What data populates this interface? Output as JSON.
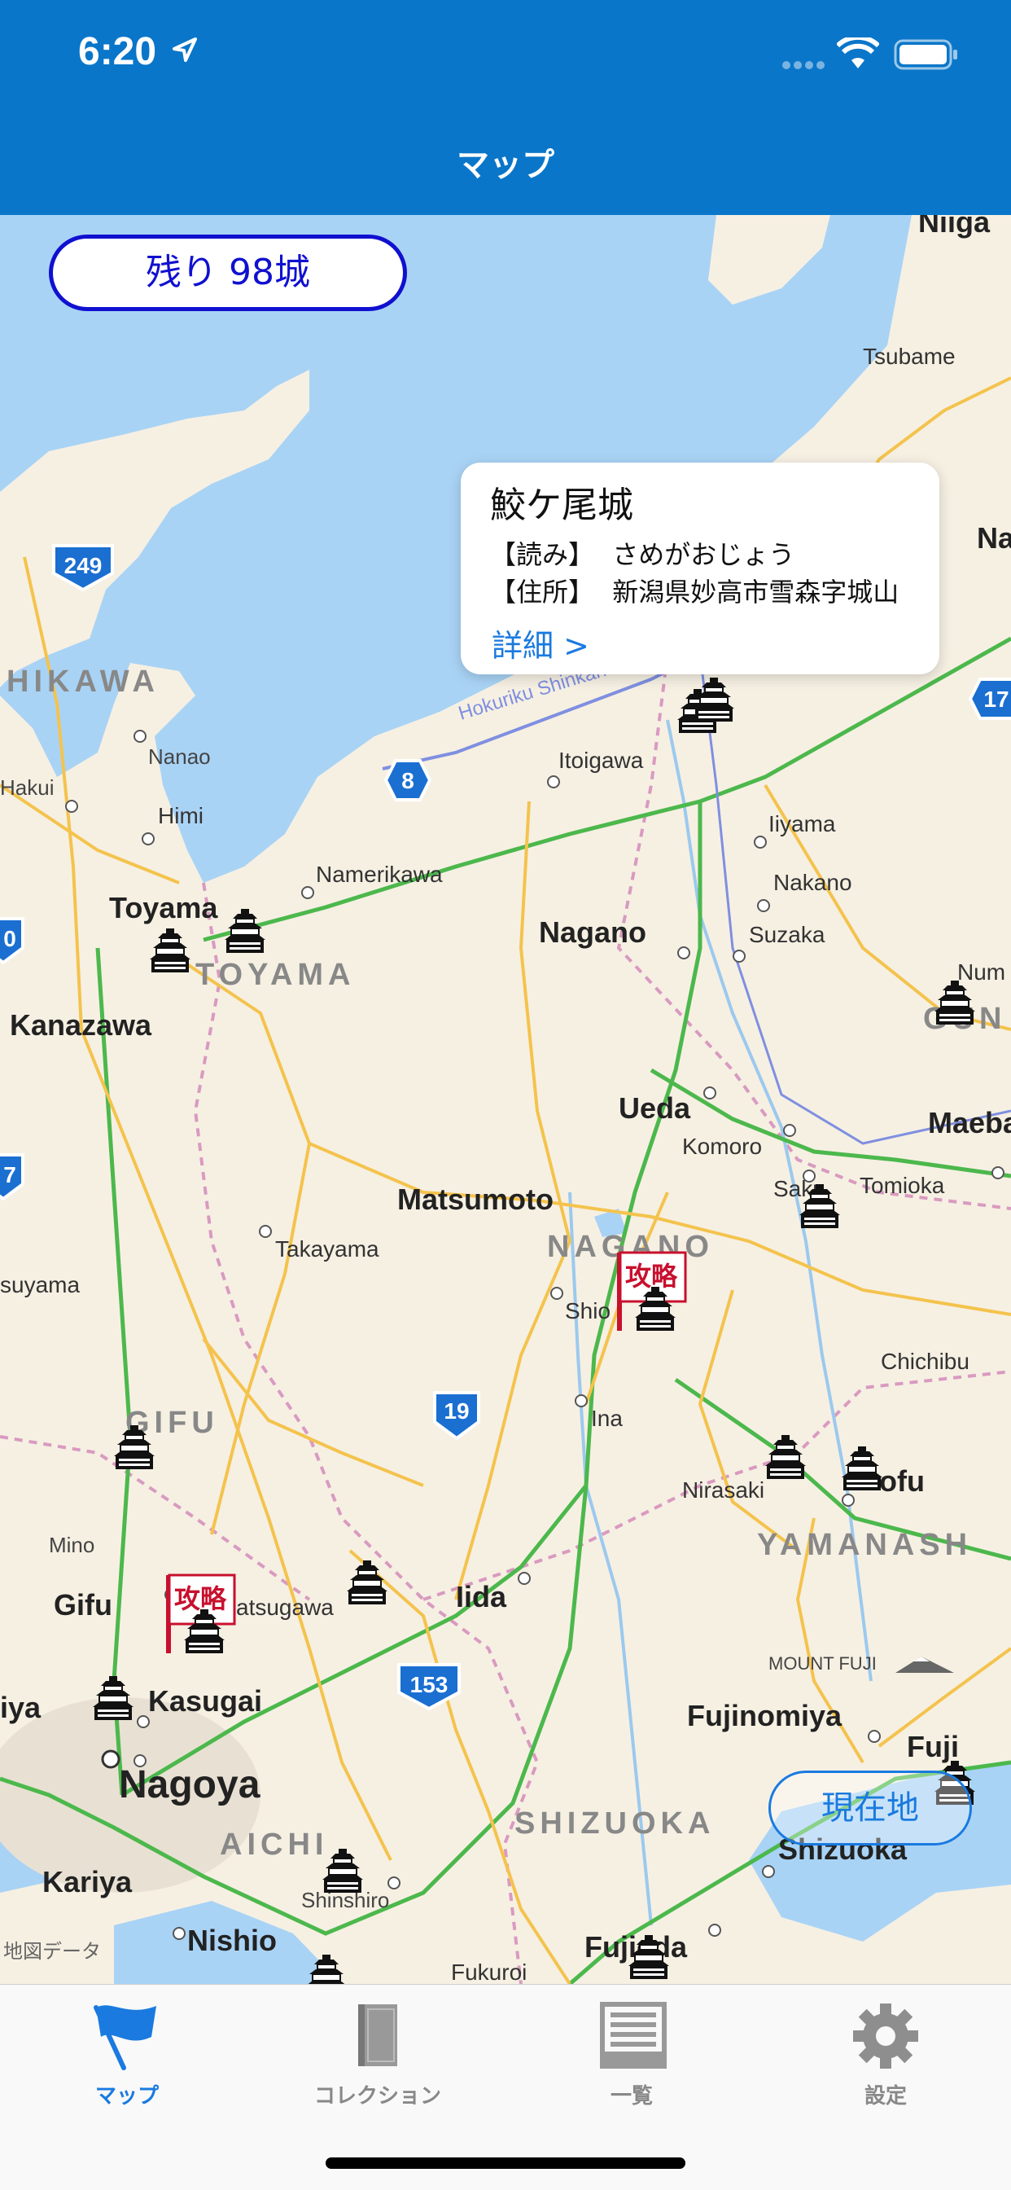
{
  "status": {
    "time": "6:20"
  },
  "nav": {
    "title": "マップ"
  },
  "map": {
    "remaining_label": "残り 98城",
    "current_location_label": "現在地",
    "attribution": "地図データ",
    "places": {
      "niigata": "Niiga",
      "tsubame": "Tsubame",
      "na": "Na",
      "hikawa": "HIKAWA",
      "nanao": "Nanao",
      "hakui": "Hakui",
      "himi": "Himi",
      "itoigawa": "Itoigawa",
      "iiyama": "Iiyama",
      "nakano": "Nakano",
      "namerikawa": "Namerikawa",
      "toyama_city": "Toyama",
      "toyama_pref": "TOYAMA",
      "nagano_city": "Nagano",
      "suzaka": "Suzaka",
      "numa": "Num",
      "gun": "GUN",
      "kanazawa": "Kanazawa",
      "ueda": "Ueda",
      "maebashi": "Maebas",
      "komoro": "Komoro",
      "saku": "Saku",
      "tomioka": "Tomioka",
      "matsumoto": "Matsumoto",
      "takayama": "Takayama",
      "nagano_pref": "NAGANO",
      "shiojiri": "Shio",
      "suyama": "suyama",
      "chichibu": "Chichibu",
      "gifu_pref": "GIFU",
      "ina": "Ina",
      "nirasaki": "Nirasaki",
      "kofu": "ofu",
      "yamanashi": "YAMANASH",
      "mino": "Mino",
      "gifu_city": "Gifu",
      "tsugawa": "atsugawa",
      "iida": "Iida",
      "mount_fuji": "MOUNT FUJI",
      "iya": "iya",
      "kasugai": "Kasugai",
      "fujinomiya": "Fujinomiya",
      "fuji": "Fuji",
      "nagoya": "Nagoya",
      "aichi": "AICHI",
      "shizuoka_pref": "SHIZUOKA",
      "shizuoka_city": "Shizuoka",
      "kariya": "Kariya",
      "shinshiro": "Shinshiro",
      "nishio": "Nishio",
      "fujieda": "Fujieda",
      "fukuroi": "Fukuroi",
      "shinkansen": "Hokuriku Shinkansen"
    },
    "routes": {
      "r249": "249",
      "r8": "8",
      "r17": "17",
      "r19": "19",
      "r153": "153",
      "r7": "7",
      "r0": "0"
    },
    "captured_badge": "攻略",
    "callout": {
      "title": "鮫ケ尾城",
      "reading_label": "【読み】",
      "reading_value": "さめがおじょう",
      "address_label": "【住所】",
      "address_value": "新潟県妙高市雪森字城山",
      "detail_link": "詳細 >"
    }
  },
  "tabs": [
    {
      "label": "マップ",
      "icon": "flag-icon",
      "active": true
    },
    {
      "label": "コレクション",
      "icon": "notebook-icon",
      "active": false
    },
    {
      "label": "一覧",
      "icon": "list-icon",
      "active": false
    },
    {
      "label": "設定",
      "icon": "gear-icon",
      "active": false
    }
  ],
  "colors": {
    "nav": "#0a76c9",
    "accent": "#1a7ae0",
    "remaining_border": "#1010d0",
    "captured": "#c8102e"
  }
}
